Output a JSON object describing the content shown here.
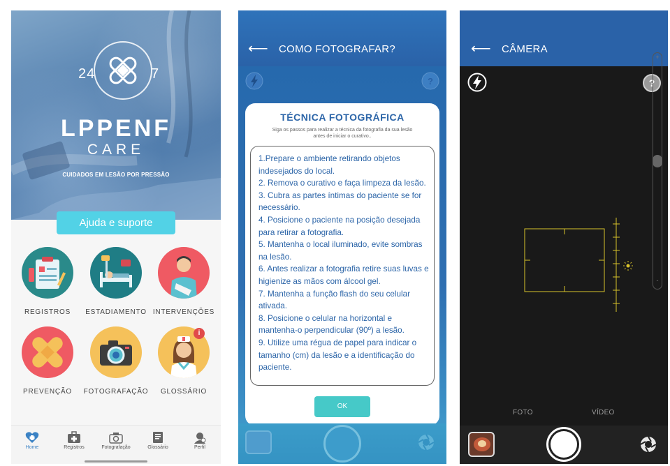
{
  "home": {
    "logo_left_number": "24",
    "logo_right_number": "7",
    "app_name": "LPPENF",
    "app_sub": "CARE",
    "tagline": "CUIDADOS EM LESÃO POR PRESSÃO",
    "help_button": "Ajuda e suporte",
    "menu": [
      {
        "label": "REGISTROS",
        "icon": "clipboard-icon",
        "color": "#2a8a8a"
      },
      {
        "label": "ESTADIAMENTO",
        "icon": "hospital-bed-icon",
        "color": "#1f7d85"
      },
      {
        "label": "INTERVENÇÕES",
        "icon": "nurse-patient-icon",
        "color": "#ef5a63"
      },
      {
        "label": "PREVENÇÃO",
        "icon": "bandage-icon",
        "color": "#ef5a63"
      },
      {
        "label": "FOTOGRAFAÇÃO",
        "icon": "camera-icon",
        "color": "#f5c15a"
      },
      {
        "label": "GLOSSÁRIO",
        "icon": "nurse-icon",
        "color": "#f5c15a"
      }
    ],
    "notification_badge": "i",
    "tabs": [
      {
        "label": "Home",
        "icon": "heart-home-icon",
        "active": true
      },
      {
        "label": "Registros",
        "icon": "medical-case-icon",
        "active": false
      },
      {
        "label": "Fotografação",
        "icon": "camera-icon",
        "active": false
      },
      {
        "label": "Glossário",
        "icon": "book-icon",
        "active": false
      },
      {
        "label": "Perfil",
        "icon": "profile-icon",
        "active": false
      }
    ]
  },
  "guide": {
    "title": "COMO FOTOGRAFAR?",
    "modal_title": "TÉCNICA FOTOGRÁFICA",
    "modal_subtitle": "Siga os passos para realizar a técnica da fotografia da sua lesão antes de iniciar o curativo..",
    "steps": [
      "1.Prepare o ambiente retirando objetos indesejados do local.",
      "2. Remova o curativo e faça limpeza da lesão.",
      "3. Cubra as partes íntimas do paciente se for necessário.",
      "4. Posicione o paciente na posição desejada para retirar a fotografia.",
      "5. Mantenha o local iluminado, evite sombras na lesão.",
      "6. Antes realizar a fotografia retire suas luvas e higienize as mãos com álcool gel.",
      "7. Mantenha a função flash do seu celular ativada.",
      "8. Posicione o celular na horizontal e mantenha-o perpendicular (90º) a lesão.",
      "9. Utilize uma régua de papel para indicar o tamanho (cm) da lesão e a identificação do paciente."
    ],
    "ok_button": "OK"
  },
  "camera": {
    "title": "CÂMERA",
    "zoom_plus": "+",
    "zoom_minus": "-",
    "modes": [
      "FOTO",
      "VÍDEO"
    ],
    "help_symbol": "?"
  },
  "colors": {
    "header_blue": "#2a62a8",
    "accent_cyan": "#52d2e6",
    "ok_teal": "#46c9c8",
    "title_blue": "#2c65a8",
    "camera_bg": "#191919",
    "focus_yellow": "#d8c22a"
  }
}
